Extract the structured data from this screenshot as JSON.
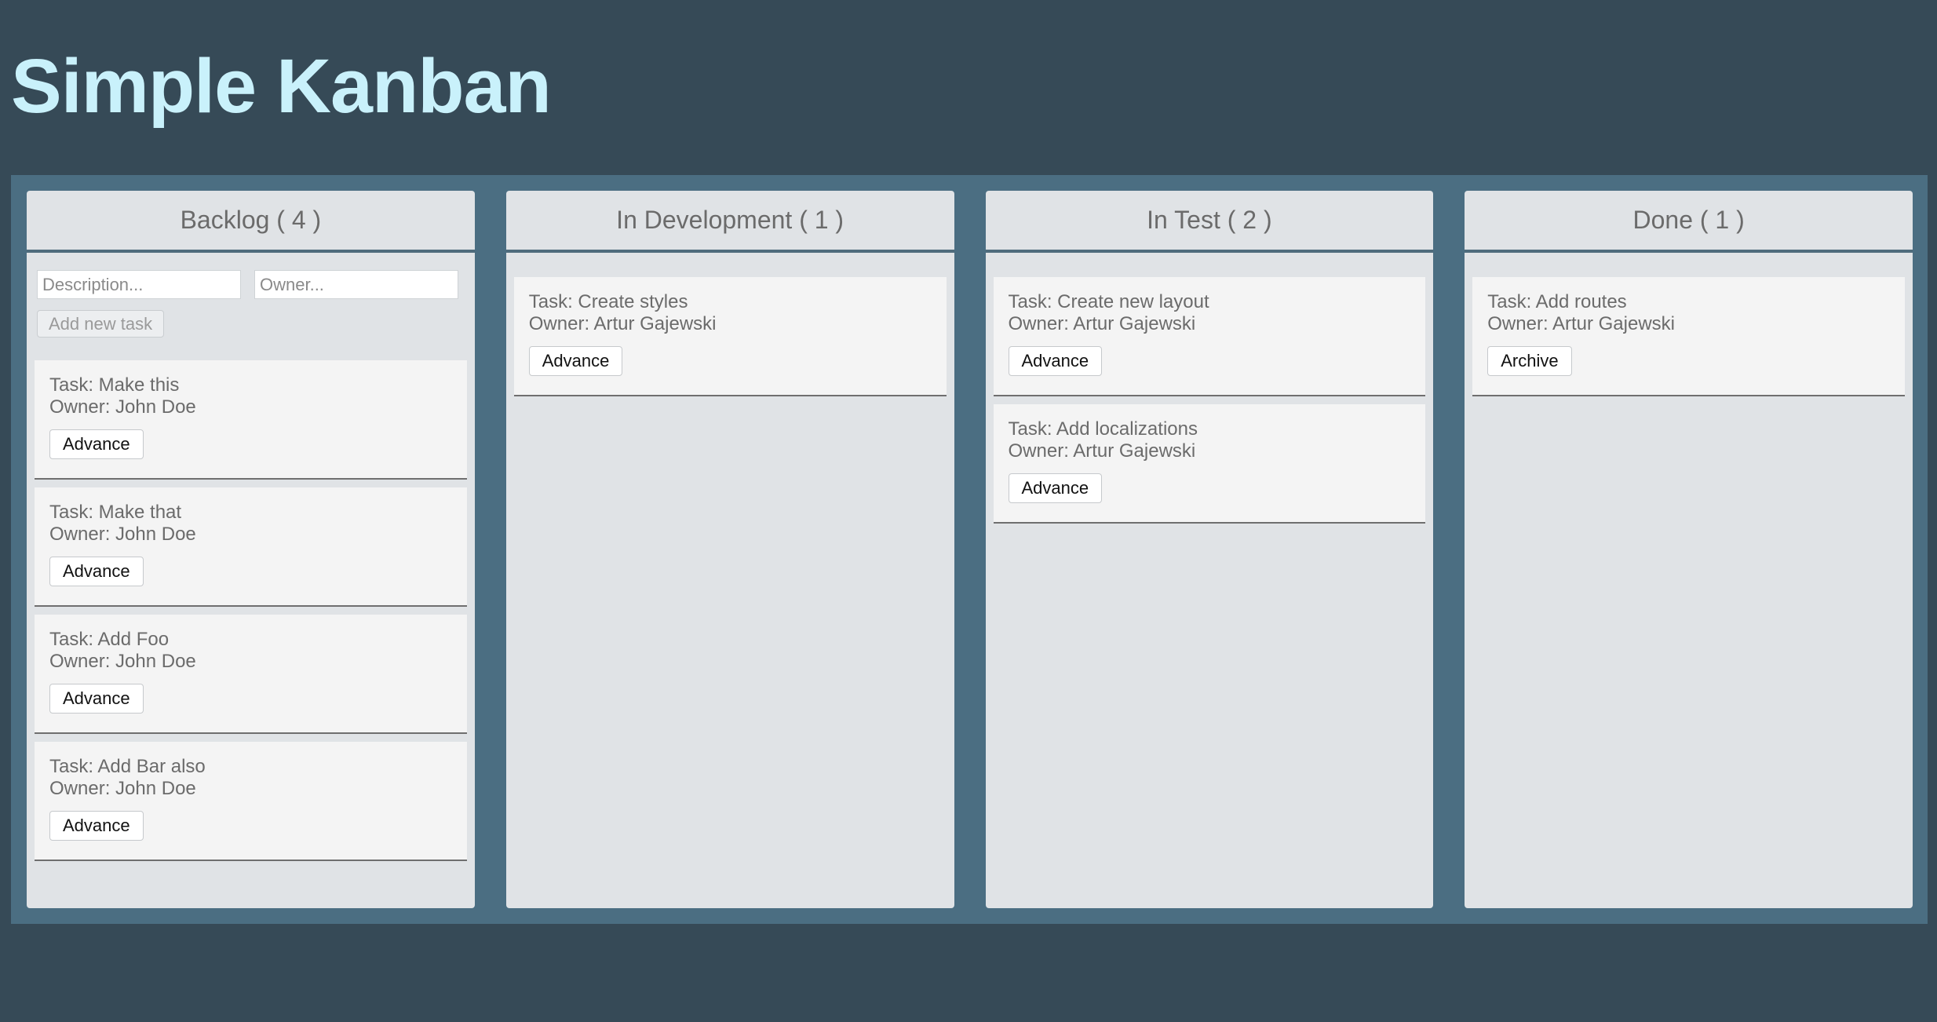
{
  "app": {
    "title": "Simple Kanban"
  },
  "columns": [
    {
      "name": "Backlog",
      "header": "Backlog ( 4 )",
      "form": {
        "description_placeholder": "Description...",
        "owner_placeholder": "Owner...",
        "add_label": "Add new task"
      },
      "tasks": [
        {
          "task": "Task: Make this",
          "owner": "Owner: John Doe",
          "action": "Advance"
        },
        {
          "task": "Task: Make that",
          "owner": "Owner: John Doe",
          "action": "Advance"
        },
        {
          "task": "Task: Add Foo",
          "owner": "Owner: John Doe",
          "action": "Advance"
        },
        {
          "task": "Task: Add Bar also",
          "owner": "Owner: John Doe",
          "action": "Advance"
        }
      ]
    },
    {
      "name": "In Development",
      "header": "In Development ( 1 )",
      "tasks": [
        {
          "task": "Task: Create styles",
          "owner": "Owner: Artur Gajewski",
          "action": "Advance"
        }
      ]
    },
    {
      "name": "In Test",
      "header": "In Test ( 2 )",
      "tasks": [
        {
          "task": "Task: Create new layout",
          "owner": "Owner: Artur Gajewski",
          "action": "Advance"
        },
        {
          "task": "Task: Add localizations",
          "owner": "Owner: Artur Gajewski",
          "action": "Advance"
        }
      ]
    },
    {
      "name": "Done",
      "header": "Done ( 1 )",
      "tasks": [
        {
          "task": "Task: Add routes",
          "owner": "Owner: Artur Gajewski",
          "action": "Archive"
        }
      ]
    }
  ],
  "colors": {
    "page_background": "#364a57",
    "board_background": "#4b6e82",
    "column_background": "#e0e3e6",
    "card_background": "#f4f4f4",
    "title_color": "#c9f1fb"
  }
}
